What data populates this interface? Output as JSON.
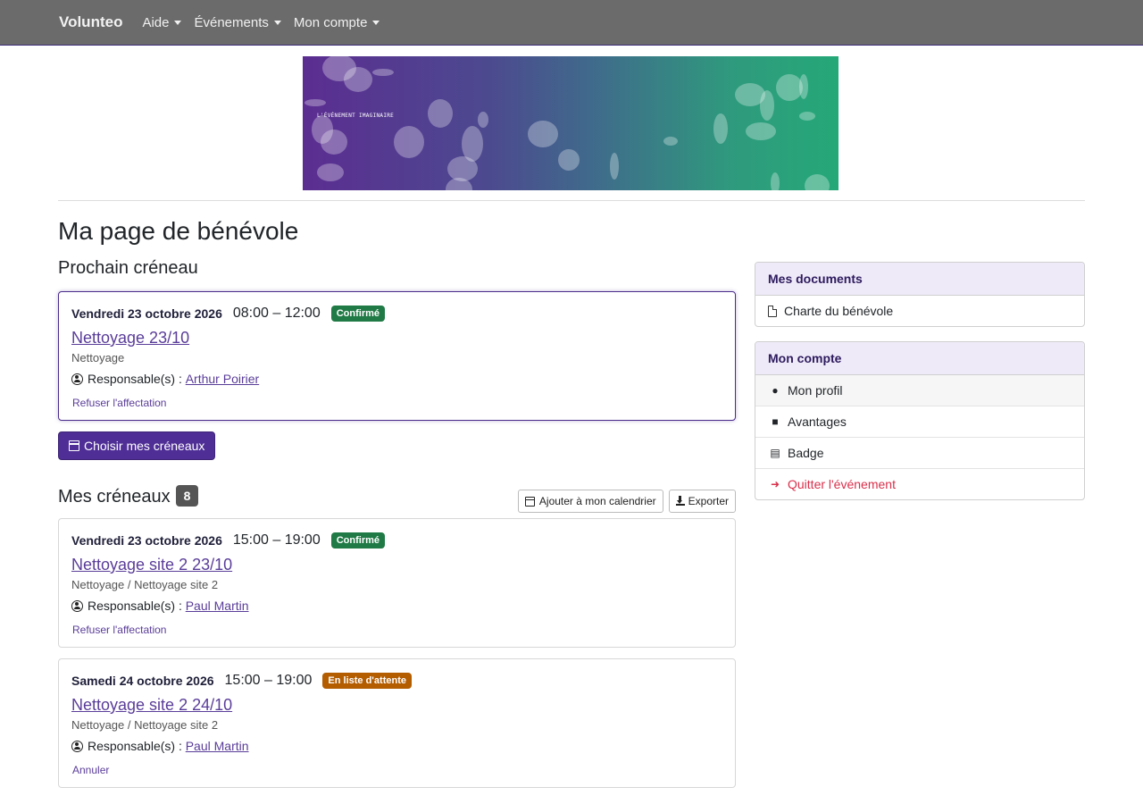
{
  "navbar": {
    "brand": "Volunteo",
    "items": [
      {
        "label": "Aide"
      },
      {
        "label": "Événements"
      },
      {
        "label": "Mon compte"
      }
    ]
  },
  "banner": {
    "text": "L'ÉVÉNEMENT IMAGINAIRE"
  },
  "page_title": "Ma page de bénévole",
  "next_slot": {
    "heading": "Prochain créneau",
    "date": "Vendredi 23 octobre 2026",
    "time": "08:00 – 12:00",
    "status": "Confirmé",
    "title": "Nettoyage 23/10",
    "subtitle": "Nettoyage",
    "responsible_label": "Responsable(s) :",
    "responsible": "Arthur Poirier",
    "action": "Refuser l'affectation"
  },
  "choose_button": "Choisir mes créneaux",
  "my_slots": {
    "heading": "Mes créneaux",
    "count": "8",
    "add_calendar": "Ajouter à mon calendrier",
    "export": "Exporter",
    "items": [
      {
        "date": "Vendredi 23 octobre 2026",
        "time": "15:00 – 19:00",
        "status": "Confirmé",
        "title": "Nettoyage site 2 23/10",
        "subtitle": "Nettoyage / Nettoyage site 2",
        "responsible_label": "Responsable(s) :",
        "responsible": "Paul Martin",
        "action": "Refuser l'affectation"
      },
      {
        "date": "Samedi 24 octobre 2026",
        "time": "15:00 – 19:00",
        "status": "En liste d'attente",
        "title": "Nettoyage site 2 24/10",
        "subtitle": "Nettoyage / Nettoyage site 2",
        "responsible_label": "Responsable(s) :",
        "responsible": "Paul Martin",
        "action": "Annuler"
      }
    ]
  },
  "documents": {
    "heading": "Mes documents",
    "items": [
      {
        "label": "Charte du bénévole"
      }
    ]
  },
  "account": {
    "heading": "Mon compte",
    "items": [
      {
        "label": "Mon profil"
      },
      {
        "label": "Avantages"
      },
      {
        "label": "Badge"
      },
      {
        "label": "Quitter l'événement"
      }
    ]
  },
  "colors": {
    "primary": "#4f2e96",
    "confirmed": "#1f7a45",
    "waiting": "#b35c00",
    "danger": "#d9304b"
  }
}
